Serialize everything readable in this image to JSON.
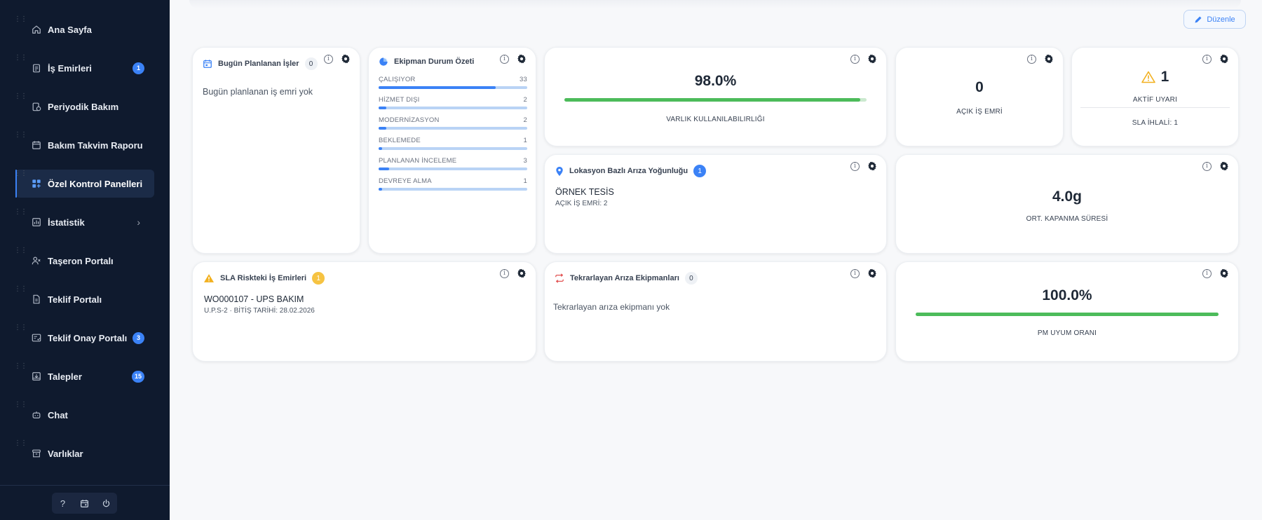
{
  "sidebar": {
    "items": [
      {
        "label": "Ana Sayfa",
        "icon": "home-icon"
      },
      {
        "label": "İş Emirleri",
        "icon": "clipboard-icon",
        "badge": "1"
      },
      {
        "label": "Periyodik Bakım",
        "icon": "calendar-clipboard-icon"
      },
      {
        "label": "Bakım Takvim Raporu",
        "icon": "calendar-icon"
      },
      {
        "label": "Özel Kontrol Panelleri",
        "icon": "dashboard-icon",
        "active": true
      },
      {
        "label": "İstatistik",
        "icon": "chart-icon",
        "chevron": "›"
      },
      {
        "label": "Taşeron Portalı",
        "icon": "contractor-icon"
      },
      {
        "label": "Teklif Portalı",
        "icon": "document-icon"
      },
      {
        "label": "Teklif Onay Portalı",
        "icon": "approval-icon",
        "badge": "3"
      },
      {
        "label": "Talepler",
        "icon": "inbox-icon",
        "badge": "15"
      },
      {
        "label": "Chat",
        "icon": "bot-icon"
      },
      {
        "label": "Varlıklar",
        "icon": "archive-icon"
      }
    ],
    "footer": {
      "help": "?",
      "calendar": "calendar-icon",
      "power": "power-icon"
    }
  },
  "toolbar": {
    "edit_label": "Düzenle"
  },
  "cards": {
    "today": {
      "title": "Bugün Planlanan İşler",
      "count": "0",
      "empty": "Bugün planlanan iş emri yok"
    },
    "equipment": {
      "title": "Ekipman Durum Özeti",
      "rows": [
        {
          "label": "ÇALIŞIYOR",
          "value": "33",
          "fraction": 0.79
        },
        {
          "label": "HİZMET DIŞI",
          "value": "2",
          "fraction": 0.05
        },
        {
          "label": "MODERNİZASYON",
          "value": "2",
          "fraction": 0.05
        },
        {
          "label": "BEKLEMEDE",
          "value": "1",
          "fraction": 0.025
        },
        {
          "label": "PLANLANAN İNCELEME",
          "value": "3",
          "fraction": 0.07
        },
        {
          "label": "DEVREYE ALMA",
          "value": "1",
          "fraction": 0.025
        }
      ]
    },
    "availability": {
      "value": "98.0%",
      "label": "VARLIK KULLANILABILIRLIĞI",
      "fraction": 0.98
    },
    "open_orders": {
      "value": "0",
      "label": "AÇIK İŞ EMRİ"
    },
    "alerts": {
      "value": "1",
      "label": "AKTİF UYARI",
      "sub": "SLA İHLALİ: 1"
    },
    "location": {
      "title": "Lokasyon Bazlı Arıza Yoğunluğu",
      "count": "1",
      "site": "ÖRNEK TESİS",
      "detail": "AÇIK İŞ EMRİ: 2"
    },
    "close_time": {
      "value": "4.0g",
      "label": "ORT. KAPANMA SÜRESİ"
    },
    "sla": {
      "title": "SLA Riskteki İş Emirleri",
      "count": "1",
      "order": "WO000107 - UPS BAKIM",
      "detail": "U.P.S-2 · BİTİŞ TARİHİ: 28.02.2026"
    },
    "recurring": {
      "title": "Tekrarlayan Arıza Ekipmanları",
      "count": "0",
      "empty": "Tekrarlayan arıza ekipmanı yok"
    },
    "pm": {
      "value": "100.0%",
      "label": "PM UYUM ORANI",
      "fraction": 1.0
    }
  },
  "colors": {
    "accent": "#3b82f6",
    "sidebar_bg": "#0f1a2e",
    "success": "#4cbb5a",
    "warning": "#f6c342",
    "danger": "#e25555"
  }
}
